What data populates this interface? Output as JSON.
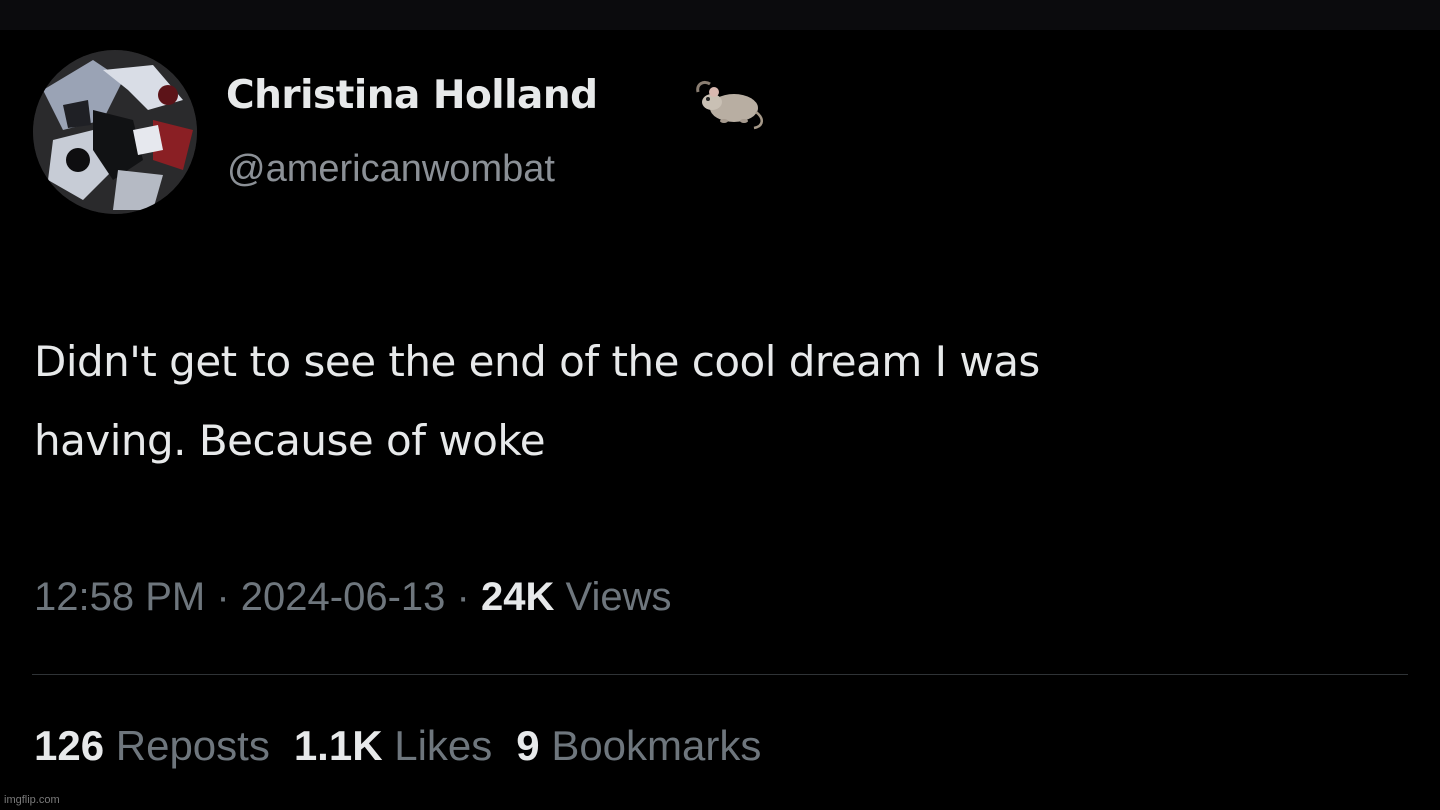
{
  "author": {
    "display_name": "Christina Holland",
    "handle": "@americanwombat",
    "name_emoji": "rat-emoji"
  },
  "tweet": {
    "text_line_1": "Didn't get to see the end of the cool dream I was",
    "text_line_2": "having. Because of woke"
  },
  "meta": {
    "time": "12:58 PM",
    "separator": "·",
    "date": "2024-06-13",
    "views_count": "24K",
    "views_label": "Views"
  },
  "stats": {
    "reposts_count": "126",
    "reposts_label": "Reposts",
    "likes_count": "1.1K",
    "likes_label": "Likes",
    "bookmarks_count": "9",
    "bookmarks_label": "Bookmarks"
  },
  "watermark": "imgflip.com",
  "colors": {
    "background": "#000000",
    "primary_text": "#e7e9ea",
    "secondary_text": "#6e767d",
    "divider": "#2f3336"
  }
}
